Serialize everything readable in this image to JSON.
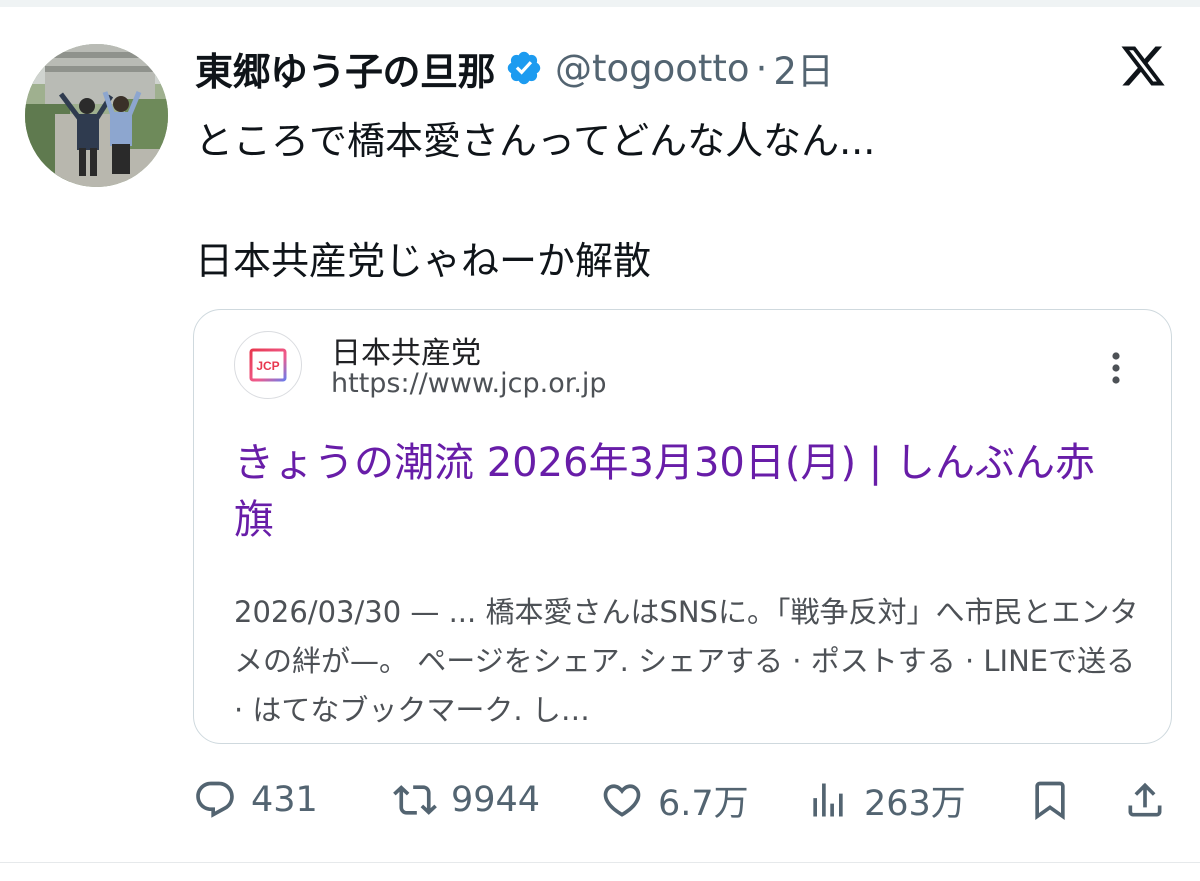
{
  "post": {
    "display_name": "東郷ゆう子の旦那",
    "handle": "@togootto",
    "separator": "·",
    "time": "2日",
    "text_line1": "ところで橋本愛さんってどんな人なん...",
    "text_line2": "日本共産党じゃねーか解散"
  },
  "card": {
    "favicon_text": "JCP",
    "site_name": "日本共産党",
    "site_url": "https://www.jcp.or.jp",
    "title": "きょうの潮流 2026年3月30日(月) | しんぶん赤旗",
    "snippet": "2026/03/30 — ... 橋本愛さんはSNSに。「戦争反対」へ市民とエンタメの絆が—。 ページをシェア. シェアする · ポストする · LINEで送る · はてなブックマーク. し…"
  },
  "actions": {
    "replies": "431",
    "reposts": "9944",
    "likes": "6.7万",
    "views": "263万"
  },
  "icons": {
    "verified": "verified-badge-icon",
    "x_logo": "x-logo-icon",
    "reply": "reply-icon",
    "repost": "repost-icon",
    "like": "heart-icon",
    "views": "views-icon",
    "bookmark": "bookmark-icon",
    "share": "share-icon",
    "more": "more-vertical-icon"
  },
  "colors": {
    "verified_blue": "#1d9bf0",
    "link_purple": "#681da8",
    "muted_gray": "#536471",
    "text": "#0f1419"
  }
}
